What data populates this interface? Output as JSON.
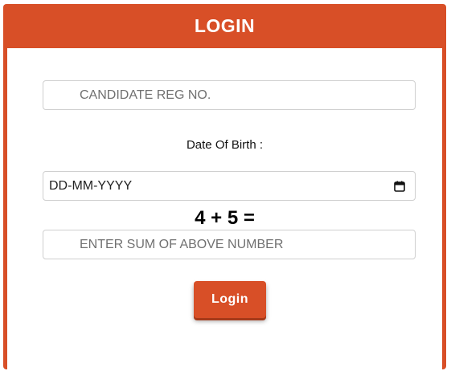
{
  "header": {
    "title": "LOGIN"
  },
  "form": {
    "reg_no_placeholder": "CANDIDATE REG NO.",
    "dob_label": "Date Of Birth :",
    "dob_value": "DD-MM-YYYY",
    "captcha_text": "4 + 5 =",
    "sum_placeholder": "ENTER SUM OF ABOVE NUMBER",
    "login_label": "Login"
  },
  "colors": {
    "accent": "#d84f27"
  },
  "icons": {
    "dob_icon": "calendar-icon"
  }
}
